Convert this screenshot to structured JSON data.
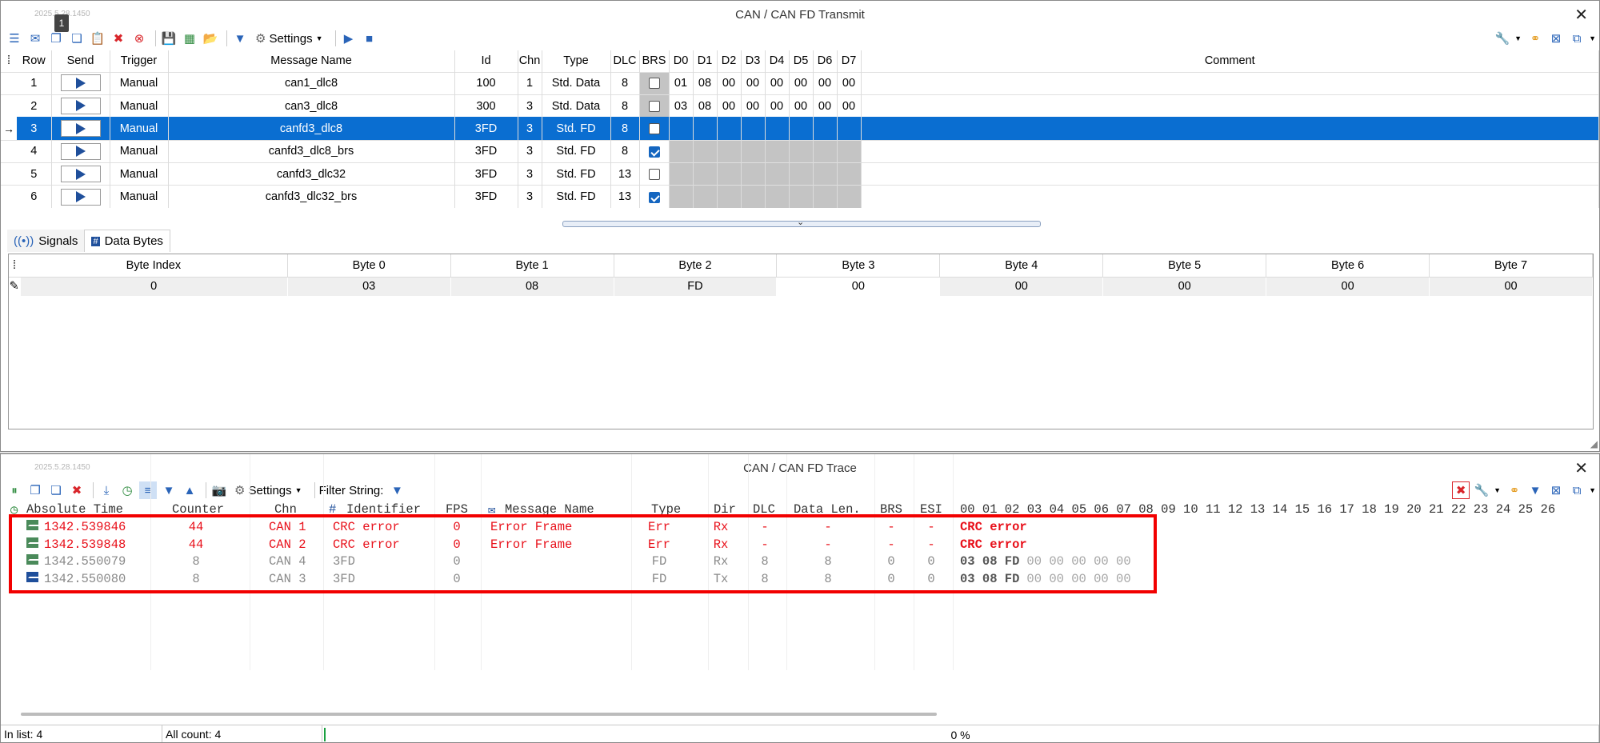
{
  "transmit": {
    "version": "2025.5.28.1450",
    "title": "CAN / CAN FD Transmit",
    "badge": "1",
    "toolbar": {
      "settings_label": "Settings"
    },
    "columns": [
      "Row",
      "Send",
      "Trigger",
      "Message Name",
      "Id",
      "Chn",
      "Type",
      "DLC",
      "BRS",
      "D0",
      "D1",
      "D2",
      "D3",
      "D4",
      "D5",
      "D6",
      "D7",
      "Comment"
    ],
    "rows": [
      {
        "row": "1",
        "trigger": "Manual",
        "name": "can1_dlc8",
        "id": "100",
        "chn": "1",
        "type": "Std. Data",
        "dlc": "8",
        "brs": false,
        "bytes": [
          "01",
          "08",
          "00",
          "00",
          "00",
          "00",
          "00",
          "00"
        ],
        "selected": false,
        "gray_bytes": false
      },
      {
        "row": "2",
        "trigger": "Manual",
        "name": "can3_dlc8",
        "id": "300",
        "chn": "3",
        "type": "Std. Data",
        "dlc": "8",
        "brs": false,
        "bytes": [
          "03",
          "08",
          "00",
          "00",
          "00",
          "00",
          "00",
          "00"
        ],
        "selected": false,
        "gray_bytes": false
      },
      {
        "row": "3",
        "trigger": "Manual",
        "name": "canfd3_dlc8",
        "id": "3FD",
        "chn": "3",
        "type": "Std. FD",
        "dlc": "8",
        "brs": false,
        "bytes": [
          "",
          "",
          "",
          "",
          "",
          "",
          "",
          ""
        ],
        "selected": true,
        "gray_bytes": false
      },
      {
        "row": "4",
        "trigger": "Manual",
        "name": "canfd3_dlc8_brs",
        "id": "3FD",
        "chn": "3",
        "type": "Std. FD",
        "dlc": "8",
        "brs": true,
        "bytes": [
          "",
          "",
          "",
          "",
          "",
          "",
          "",
          ""
        ],
        "selected": false,
        "gray_bytes": true
      },
      {
        "row": "5",
        "trigger": "Manual",
        "name": "canfd3_dlc32",
        "id": "3FD",
        "chn": "3",
        "type": "Std. FD",
        "dlc": "13",
        "brs": false,
        "bytes": [
          "",
          "",
          "",
          "",
          "",
          "",
          "",
          ""
        ],
        "selected": false,
        "gray_bytes": true
      },
      {
        "row": "6",
        "trigger": "Manual",
        "name": "canfd3_dlc32_brs",
        "id": "3FD",
        "chn": "3",
        "type": "Std. FD",
        "dlc": "13",
        "brs": true,
        "bytes": [
          "",
          "",
          "",
          "",
          "",
          "",
          "",
          ""
        ],
        "selected": false,
        "gray_bytes": true
      }
    ],
    "tabs": {
      "signals": "Signals",
      "data_bytes": "Data Bytes"
    },
    "bytes_table": {
      "headers": [
        "Byte Index",
        "Byte 0",
        "Byte 1",
        "Byte 2",
        "Byte 3",
        "Byte 4",
        "Byte 5",
        "Byte 6",
        "Byte 7"
      ],
      "values": [
        "0",
        "03",
        "08",
        "FD",
        "00",
        "00",
        "00",
        "00",
        "00"
      ]
    }
  },
  "trace": {
    "version": "2025.5.28.1450",
    "title": "CAN / CAN FD Trace",
    "toolbar": {
      "settings_label": "Settings",
      "filter_label": "Filter String:"
    },
    "columns": {
      "time": "Absolute Time",
      "counter": "Counter",
      "chn": "Chn",
      "identifier": "Identifier",
      "fps": "FPS",
      "message_name": "Message Name",
      "type": "Type",
      "dir": "Dir",
      "dlc": "DLC",
      "data_len": "Data Len.",
      "brs": "BRS",
      "esi": "ESI",
      "bytes": "00 01 02 03 04 05 06 07 08 09 10 11 12 13 14 15 16 17 18 19 20 21 22 23 24 25 26"
    },
    "rows": [
      {
        "kind": "err",
        "icon": "green",
        "time": "1342.539846",
        "counter": "44",
        "chn": "CAN 1",
        "identifier": "CRC error",
        "fps": "0",
        "message_name": "Error Frame",
        "type": "Err",
        "dir": "Rx",
        "dlc": "-",
        "data_len": "-",
        "brs": "-",
        "esi": "-",
        "data_bold": "CRC error",
        "data_rest": ""
      },
      {
        "kind": "err",
        "icon": "green",
        "time": "1342.539848",
        "counter": "44",
        "chn": "CAN 2",
        "identifier": "CRC error",
        "fps": "0",
        "message_name": "Error Frame",
        "type": "Err",
        "dir": "Rx",
        "dlc": "-",
        "data_len": "-",
        "brs": "-",
        "esi": "-",
        "data_bold": "CRC error",
        "data_rest": ""
      },
      {
        "kind": "ok",
        "icon": "green",
        "time": "1342.550079",
        "counter": "8",
        "chn": "CAN 4",
        "identifier": "3FD",
        "fps": "0",
        "message_name": "",
        "type": "FD",
        "dir": "Rx",
        "dlc": "8",
        "data_len": "8",
        "brs": "0",
        "esi": "0",
        "data_bold": "03 08 FD",
        "data_rest": "00 00 00 00 00"
      },
      {
        "kind": "ok",
        "icon": "blue",
        "time": "1342.550080",
        "counter": "8",
        "chn": "CAN 3",
        "identifier": "3FD",
        "fps": "0",
        "message_name": "",
        "type": "FD",
        "dir": "Tx",
        "dlc": "8",
        "data_len": "8",
        "brs": "0",
        "esi": "0",
        "data_bold": "03 08 FD",
        "data_rest": "00 00 00 00 00"
      }
    ],
    "status": {
      "in_list": "In list: 4",
      "all_count": "All count: 4",
      "progress": "0 %"
    }
  },
  "colors": {
    "selection": "#0a6ed1",
    "error_text": "#e8101a",
    "highlight_frame": "#f20000"
  }
}
